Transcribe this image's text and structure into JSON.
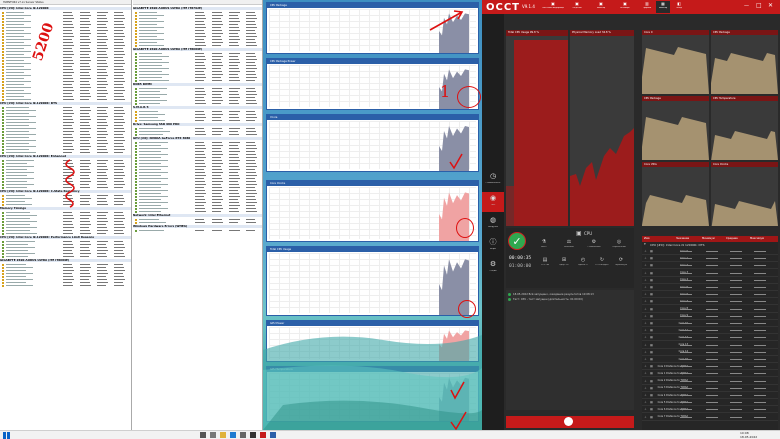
{
  "hwinfo_left": {
    "title": "HWiNFO64 v7.xx Sensor Status",
    "sections": [
      {
        "name": "CPU [#0]: Intel Core i9-12900K",
        "rows": 30
      },
      {
        "name": "CPU [#0]: Intel Core i9-12900K: DTS",
        "rows": 16
      },
      {
        "name": "CPU [#0]: Intel Core i9-12900K: Enhanced",
        "rows": 10
      },
      {
        "name": "CPU [#0]: Intel Core i9-12900K: C-State Residency",
        "rows": 4
      },
      {
        "name": "Memory Timings",
        "rows": 8
      },
      {
        "name": "CPU [#0]: Intel Core i9-12900K: Performance Limit Reasons",
        "rows": 6
      },
      {
        "name": "GIGABYTE Z690 AORUS ULTRA (ITE IT8689E)",
        "rows": 8
      }
    ]
  },
  "hwinfo_right": {
    "sections": [
      {
        "name": "GIGABYTE Z690 AORUS ULTRA (ITE IT8792E)",
        "rows": 12
      },
      {
        "name": "GIGABYTE Z690 AORUS ULTRA (ITE IT8689E)",
        "rows": 10
      },
      {
        "name": "DDR5 DIMM",
        "rows": 6
      },
      {
        "name": "S.M.A.R.T.",
        "rows": 4
      },
      {
        "name": "Drive: Samsung SSD 980 PRO",
        "rows": 3
      },
      {
        "name": "GPU [#0]: NVIDIA GeForce RTX 3080",
        "rows": 24
      },
      {
        "name": "Network: Intel Ethernet",
        "rows": 2
      },
      {
        "name": "Windows Hardware Errors (WHEA)",
        "rows": 1
      }
    ]
  },
  "graph_windows": [
    {
      "title": "CPU Package",
      "value": "",
      "circled": true
    },
    {
      "title": "CPU Package Power",
      "value": "",
      "circled": true
    },
    {
      "title": "Vcore",
      "value": "",
      "circled": false
    },
    {
      "title": "Core Clocks",
      "value": "",
      "circled": true
    },
    {
      "title": "Total CPU Usage",
      "value": "",
      "circled": true
    },
    {
      "title": "GPU Power",
      "value": "",
      "circled": true
    },
    {
      "title": "GPU Temperature",
      "value": "",
      "circled": true
    }
  ],
  "annotations": {
    "freq": "5200",
    "one": "1"
  },
  "occt": {
    "logo": "OCCT",
    "version": "V9.1.4",
    "title_buttons": [
      "Системная информация",
      "Сведения",
      "Монитор",
      "Бенчмарк"
    ],
    "sidebar": [
      "Стабильность",
      "Тест",
      "Нагрузка",
      "Инфо",
      "Опции"
    ],
    "graph_left_label": "Total CPU Usage",
    "graph_left_value": "99.8 %",
    "graph_right_label": "Physical Memory Load",
    "graph_right_value": "34.8 %",
    "test_name": "CPU",
    "timer_top": "00:00:35",
    "timer_bottom": "01:00:00",
    "controls": [
      "AVX2",
      "Большой",
      "Стабильный",
      "Переменный"
    ],
    "stats": [
      "12.5 GB",
      "Ядер: 16",
      "Время: 0",
      "0 (Стандарт)",
      "Перезапуск"
    ],
    "log": [
      "18.05.2022 Всё запущено, ожидание результатов 10:08:13",
      "Тест: CPU - тест запущен (длительность: 01:00:00)"
    ],
    "monitor_tabs": [
      "Графики",
      "Монитор",
      "Обзор"
    ],
    "monitor_graphs": [
      {
        "label": "Core 0",
        "value": ""
      },
      {
        "label": "CPU Package",
        "value": ""
      },
      {
        "label": "CPU Package",
        "value": ""
      },
      {
        "label": "CPU Temperature",
        "value": ""
      },
      {
        "label": "Core VIDs",
        "value": ""
      },
      {
        "label": "Core Clocks",
        "value": ""
      }
    ],
    "table_headers": [
      "Имя",
      "Значение",
      "Минимум",
      "Среднее",
      "Максимум"
    ],
    "table_group": "CPU [#0]: Intel Core i9 12900K: DTS",
    "table_rows": [
      "Core 0",
      "Core 1",
      "Core 2",
      "Core 3",
      "Core 4",
      "Core 5",
      "Core 6",
      "Core 7",
      "Core 8",
      "Core 9",
      "Core 10",
      "Core 11",
      "Core 12",
      "Core 13",
      "Core 14",
      "Core 15",
      "Core 0 Distance to TjMAX",
      "Core 1 Distance to TjMAX",
      "Core 2 Distance to TjMAX",
      "Core 3 Distance to TjMAX",
      "Core 4 Distance to TjMAX",
      "Core 5 Distance to TjMAX",
      "Core 6 Distance to TjMAX",
      "Core 7 Distance to TjMAX"
    ]
  },
  "taskbar": {
    "time": "10:08",
    "date": "18.05.2022"
  }
}
